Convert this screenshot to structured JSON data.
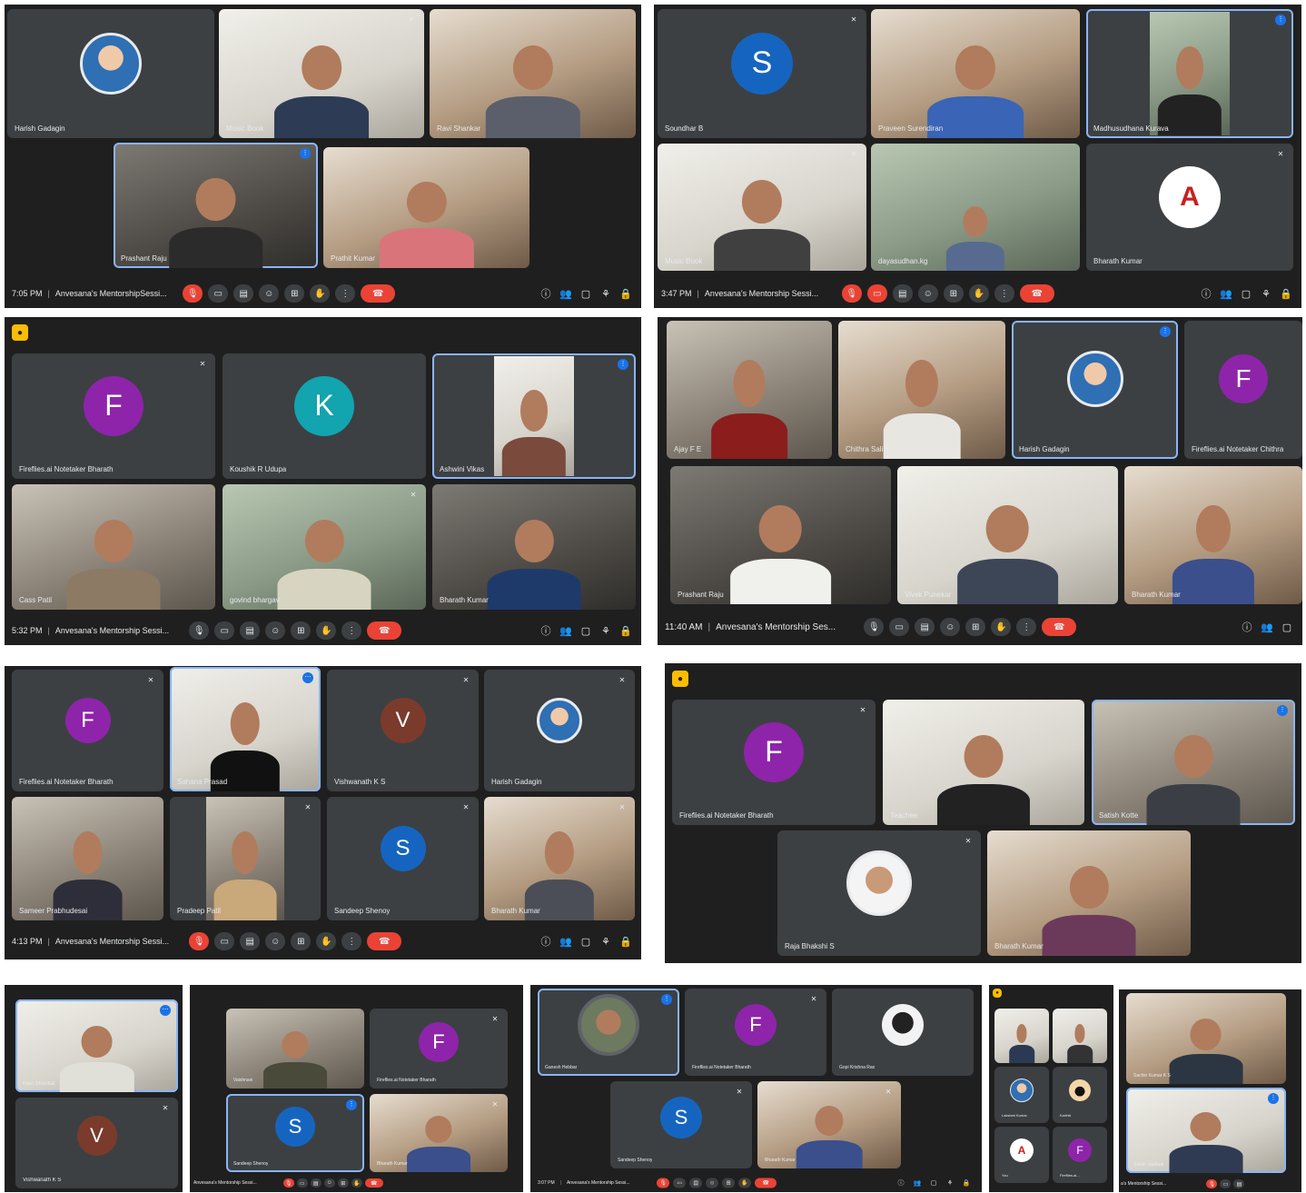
{
  "panels": [
    {
      "time": "7:05 PM",
      "meeting": "Anvesana's MentorshipSessi...",
      "tiles": [
        {
          "name": "Harish Gadagin"
        },
        {
          "name": "Music Book"
        },
        {
          "name": "Ravi Shankar"
        },
        {
          "name": "Prashant Raju"
        },
        {
          "name": "Prathit Kumar"
        }
      ]
    },
    {
      "time": "3:47 PM",
      "meeting": "Anvesana's Mentorship Sessi...",
      "tiles": [
        {
          "name": "Soundhar B",
          "initial": "S"
        },
        {
          "name": "Praveen Surendiran"
        },
        {
          "name": "Madhusudhana Kurava"
        },
        {
          "name": "Music Book"
        },
        {
          "name": "dayasudhan.kg"
        },
        {
          "name": "Bharath Kumar"
        }
      ]
    },
    {
      "time": "5:32 PM",
      "meeting": "Anvesana's Mentorship Sessi...",
      "tiles": [
        {
          "name": "Fireflies.ai Notetaker Bharath",
          "initial": "F"
        },
        {
          "name": "Koushik R Udupa",
          "initial": "K"
        },
        {
          "name": "Ashwini Vikas"
        },
        {
          "name": "Cass Patil"
        },
        {
          "name": "govind bhargav"
        },
        {
          "name": "Bharath Kumar"
        }
      ]
    },
    {
      "time": "11:40 AM",
      "meeting": "Anvesana's Mentorship Ses...",
      "tiles": [
        {
          "name": "Ajay F E"
        },
        {
          "name": "Chithra Salin"
        },
        {
          "name": "Harish Gadagin"
        },
        {
          "name": "Fireflies.ai Notetaker Chithra",
          "initial": "F"
        },
        {
          "name": "Prashant Raju"
        },
        {
          "name": "Vivek Punekar"
        },
        {
          "name": "Bharath Kumar"
        }
      ]
    },
    {
      "time": "4:13 PM",
      "meeting": "Anvesana's Mentorship Sessi...",
      "tiles": [
        {
          "name": "Fireflies.ai Notetaker Bharath",
          "initial": "F"
        },
        {
          "name": "Sahana Prasad"
        },
        {
          "name": "Vishwanath K S",
          "initial": "V"
        },
        {
          "name": "Harish Gadagin"
        },
        {
          "name": "Sameer Prabhudesai"
        },
        {
          "name": "Pradeep Patil"
        },
        {
          "name": "Sandeep Shenoy",
          "initial": "S"
        },
        {
          "name": "Bharath Kumar"
        }
      ]
    },
    {
      "tiles": [
        {
          "name": "Fireflies.ai Notetaker Bharath",
          "initial": "F"
        },
        {
          "name": "Teachee"
        },
        {
          "name": "Satish Kotte"
        },
        {
          "name": "Raja Bhakshi S"
        },
        {
          "name": "Bharath Kumar"
        }
      ]
    },
    {
      "tiles": [
        {
          "name": "Ravi Shankar"
        },
        {
          "name": "Vishwanath K S",
          "initial": "V"
        }
      ]
    },
    {
      "meeting": "Anvesana's Mentorship Sessi...",
      "tiles": [
        {
          "name": "Vaishnavi"
        },
        {
          "name": "Fireflies.ai Notetaker Bharath",
          "initial": "F"
        },
        {
          "name": "Sandeep Shenoy",
          "initial": "S"
        },
        {
          "name": "Bharath Kumar"
        }
      ]
    },
    {
      "time": "3:07 PM",
      "meeting": "Anvesana's Mentorship Sessi...",
      "tiles": [
        {
          "name": "Ganesh Hebbar"
        },
        {
          "name": "Fireflies.ai Notetaker Bharath",
          "initial": "F"
        },
        {
          "name": "Gopi Krishna Rao"
        },
        {
          "name": "Sandeep Shenoy",
          "initial": "S"
        },
        {
          "name": "Bharath Kumar"
        }
      ]
    },
    {
      "tiles": [
        {
          "name": "Lakshmi Kumar"
        },
        {
          "name": "Karthik"
        },
        {
          "name": "You"
        },
        {
          "name": "Fireflies.ai..."
        }
      ]
    },
    {
      "meeting": "a's Mentorship Sessi...",
      "tiles": [
        {
          "name": "Sachin Kumar K S"
        },
        {
          "name": "Satish Vaddadi"
        }
      ]
    }
  ],
  "colors": {
    "panel_bg": "#1f1f1f",
    "tile_bg": "#3c4043",
    "accent": "#8ab4f8",
    "hangup": "#ea4335",
    "avatar_purple": "#8e24aa",
    "avatar_teal": "#12a4af",
    "avatar_blue": "#1565c0",
    "avatar_brown": "#7b3b2c"
  },
  "icons": {
    "hand": "raise-hand-icon",
    "mic": "mic-off-icon",
    "camera": "camera-icon",
    "captions": "captions-icon",
    "emoji": "emoji-icon",
    "present": "present-icon",
    "more": "more-icon",
    "hangup": "hangup-icon",
    "info": "info-icon",
    "people": "people-icon",
    "chat": "chat-icon",
    "activities": "activities-icon",
    "lock": "lock-icon",
    "recording": "recording-icon"
  }
}
